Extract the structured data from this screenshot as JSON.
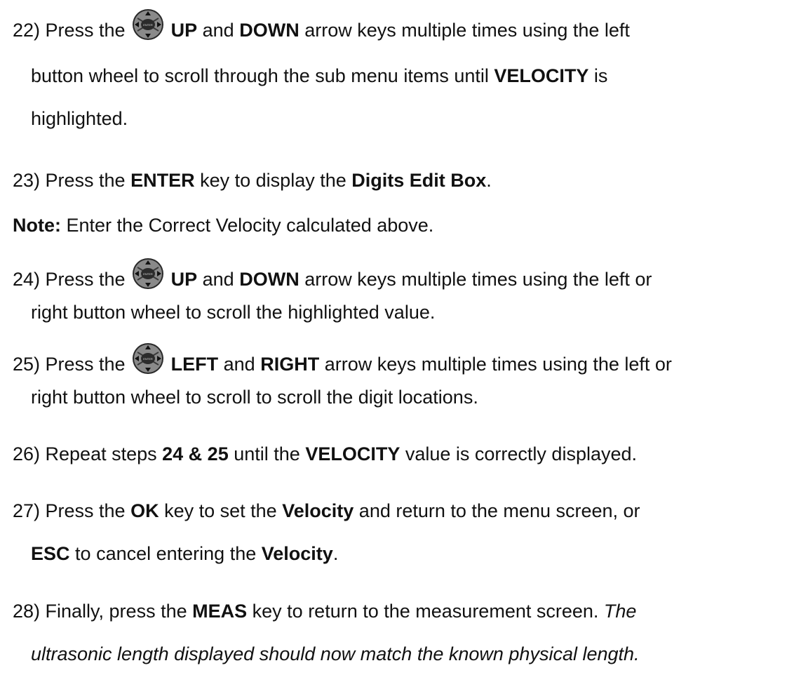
{
  "steps": {
    "s22": {
      "num": "22) Press the",
      "up": "UP",
      "and": "and",
      "down": "DOWN",
      "rest1": "arrow keys multiple times using the left",
      "line2a": "button wheel to scroll through the sub menu items until",
      "velocity": "VELOCITY",
      "line2b": "is",
      "line3": "highlighted."
    },
    "s23": {
      "num": "23) Press the",
      "enter": "ENTER",
      "mid": "key to display the",
      "box": "Digits Edit Box",
      "end": "."
    },
    "note": {
      "label": "Note:",
      "text": "Enter the Correct Velocity calculated above."
    },
    "s24": {
      "num": "24) Press the",
      "up": "UP",
      "and": "and",
      "down": "DOWN",
      "rest1": "arrow keys multiple times using the left or",
      "line2": "right button wheel to scroll the highlighted value."
    },
    "s25": {
      "num": "25) Press the",
      "left": "LEFT",
      "and": "and",
      "right": "RIGHT",
      "rest1": "arrow keys multiple times using the left or",
      "line2": "right button wheel to scroll to scroll the digit locations."
    },
    "s26": {
      "num": "26) Repeat steps",
      "steps": "24 & 25",
      "mid": "until the",
      "velocity": "VELOCITY",
      "end": "value is correctly displayed."
    },
    "s27": {
      "num": "27) Press the",
      "ok": "OK",
      "mid": "key to set the",
      "velocity": "Velocity",
      "end": "and return to the menu screen, or",
      "esc": "ESC",
      "mid2": "to cancel entering the",
      "velocity2": "Velocity",
      "end2": "."
    },
    "s28": {
      "num": "28) Finally, press the",
      "meas": "MEAS",
      "mid": "key to return to the measurement screen.",
      "italic1": "The",
      "italic2": "ultrasonic length displayed should now match the known physical length."
    }
  },
  "icons": {
    "wheel": "button-wheel-icon",
    "wheel_center_text": "ENTER"
  }
}
